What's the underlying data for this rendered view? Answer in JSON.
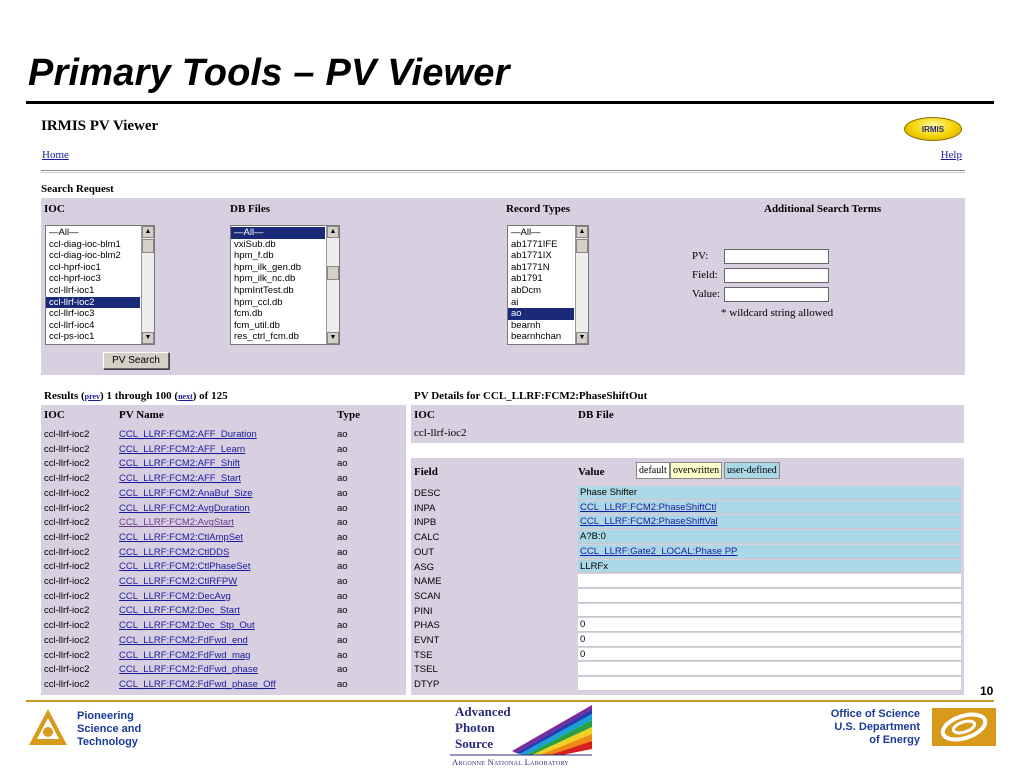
{
  "slide": {
    "title": "Primary Tools – PV Viewer",
    "page_number": "10",
    "footer_left": [
      "Pioneering",
      "Science and",
      "Technology"
    ],
    "aps_lines": [
      "Advanced",
      "Photon",
      "Source"
    ],
    "aps_sub": "Argonne National Laboratory",
    "footer_right": [
      "Office of Science",
      "U.S. Department",
      "of Energy"
    ]
  },
  "app": {
    "title": "IRMIS PV Viewer",
    "badge": "IRMIS",
    "home_link": "Home",
    "help_link": "Help",
    "search_heading": "Search Request"
  },
  "search": {
    "headers": {
      "ioc": "IOC",
      "db_files": "DB Files",
      "record_types": "Record Types",
      "additional": "Additional Search Terms"
    },
    "ioc_options": [
      "—All—",
      "ccl-diag-ioc-blm1",
      "ccl-diag-ioc-blm2",
      "ccl-hprf-ioc1",
      "ccl-hprf-ioc3",
      "ccl-llrf-ioc1",
      "ccl-llrf-ioc2",
      "ccl-llrf-ioc3",
      "ccl-llrf-ioc4",
      "ccl-ps-ioc1"
    ],
    "ioc_selected": 6,
    "db_options": [
      "—All—",
      "vxiSub.db",
      "hpm_f.db",
      "hpm_ilk_gen.db",
      "hpm_ilk_nc.db",
      "hpmIntTest.db",
      "hpm_ccl.db",
      "fcm.db",
      "fcm_util.db",
      "res_ctrl_fcm.db"
    ],
    "db_selected": 0,
    "record_options": [
      "—All—",
      "ab1771IFE",
      "ab1771IX",
      "ab1771N",
      "ab1791",
      "abDcm",
      "ai",
      "ao",
      "bearnh",
      "bearnhchan"
    ],
    "record_selected": 7,
    "pv_label": "PV:",
    "field_label": "Field:",
    "value_label": "Value:",
    "pv_value": "",
    "field_value": "",
    "value_value": "",
    "wildcard_note": "* wildcard string allowed",
    "button_label": "PV Search"
  },
  "results": {
    "prefix": "Results (",
    "prev_label": "prev",
    "middle": ") 1 through 100 (",
    "next_label": "next",
    "suffix": ") of 125",
    "headers": {
      "ioc": "IOC",
      "pv_name": "PV Name",
      "type": "Type"
    },
    "rows": [
      {
        "ioc": "ccl-llrf-ioc2",
        "pv": "CCL_LLRF:FCM2:AFF_Duration",
        "type": "ao"
      },
      {
        "ioc": "ccl-llrf-ioc2",
        "pv": "CCL_LLRF:FCM2:AFF_Learn",
        "type": "ao"
      },
      {
        "ioc": "ccl-llrf-ioc2",
        "pv": "CCL_LLRF:FCM2:AFF_Shift",
        "type": "ao"
      },
      {
        "ioc": "ccl-llrf-ioc2",
        "pv": "CCL_LLRF:FCM2:AFF_Start",
        "type": "ao"
      },
      {
        "ioc": "ccl-llrf-ioc2",
        "pv": "CCL_LLRF:FCM2:AnaBuf_Size",
        "type": "ao"
      },
      {
        "ioc": "ccl-llrf-ioc2",
        "pv": "CCL_LLRF:FCM2:AvgDuration",
        "type": "ao"
      },
      {
        "ioc": "ccl-llrf-ioc2",
        "pv": "CCL_LLRF:FCM2:AvgStart",
        "type": "ao"
      },
      {
        "ioc": "ccl-llrf-ioc2",
        "pv": "CCL_LLRF:FCM2:CtlAmpSet",
        "type": "ao"
      },
      {
        "ioc": "ccl-llrf-ioc2",
        "pv": "CCL_LLRF:FCM2:CtlDDS",
        "type": "ao"
      },
      {
        "ioc": "ccl-llrf-ioc2",
        "pv": "CCL_LLRF:FCM2:CtlPhaseSet",
        "type": "ao"
      },
      {
        "ioc": "ccl-llrf-ioc2",
        "pv": "CCL_LLRF:FCM2:CtlRFPW",
        "type": "ao"
      },
      {
        "ioc": "ccl-llrf-ioc2",
        "pv": "CCL_LLRF:FCM2:DecAvg",
        "type": "ao"
      },
      {
        "ioc": "ccl-llrf-ioc2",
        "pv": "CCL_LLRF:FCM2:Dec_Start",
        "type": "ao"
      },
      {
        "ioc": "ccl-llrf-ioc2",
        "pv": "CCL_LLRF:FCM2:Dec_Stp_Out",
        "type": "ao"
      },
      {
        "ioc": "ccl-llrf-ioc2",
        "pv": "CCL_LLRF:FCM2:FdFwd_end",
        "type": "ao"
      },
      {
        "ioc": "ccl-llrf-ioc2",
        "pv": "CCL_LLRF:FCM2:FdFwd_mag",
        "type": "ao"
      },
      {
        "ioc": "ccl-llrf-ioc2",
        "pv": "CCL_LLRF:FCM2:FdFwd_phase",
        "type": "ao"
      },
      {
        "ioc": "ccl-llrf-ioc2",
        "pv": "CCL_LLRF:FCM2:FdFwd_phase_Off",
        "type": "ao"
      }
    ]
  },
  "details": {
    "heading": "PV Details for CCL_LLRF:FCM2:PhaseShiftOut",
    "ioc_header": "IOC",
    "db_file_header": "DB File",
    "ioc_value": "ccl-llrf-ioc2",
    "field_header": "Field",
    "value_header": "Value",
    "legend": {
      "default": "default",
      "overwritten": "overwritten",
      "user_defined": "user-defined"
    },
    "legend_colors": {
      "default": "#ffffff",
      "overwritten": "#ffffcc",
      "user_defined": "#aad8e6"
    },
    "fields": [
      {
        "name": "DESC",
        "value": "Phase Shifter",
        "link": false,
        "kind": "udef"
      },
      {
        "name": "INPA",
        "value": "CCL_LLRF:FCM2:PhaseShiftCtl",
        "link": true,
        "kind": "udef"
      },
      {
        "name": "INPB",
        "value": "CCL_LLRF:FCM2:PhaseShiftVal",
        "link": true,
        "kind": "udef"
      },
      {
        "name": "CALC",
        "value": "A?B:0",
        "link": false,
        "kind": "udef"
      },
      {
        "name": "OUT",
        "value": "CCL_LLRF:Gate2_LOCAL:Phase PP",
        "link": true,
        "kind": "udef"
      },
      {
        "name": "ASG",
        "value": "LLRFx",
        "link": false,
        "kind": "udef"
      },
      {
        "name": "NAME",
        "value": "",
        "link": false,
        "kind": "plain"
      },
      {
        "name": "SCAN",
        "value": "",
        "link": false,
        "kind": "plain"
      },
      {
        "name": "PINI",
        "value": "",
        "link": false,
        "kind": "plain"
      },
      {
        "name": "PHAS",
        "value": "0",
        "link": false,
        "kind": "plain"
      },
      {
        "name": "EVNT",
        "value": "0",
        "link": false,
        "kind": "plain"
      },
      {
        "name": "TSE",
        "value": "0",
        "link": false,
        "kind": "plain"
      },
      {
        "name": "TSEL",
        "value": "",
        "link": false,
        "kind": "plain"
      },
      {
        "name": "DTYP",
        "value": "",
        "link": false,
        "kind": "plain"
      }
    ]
  }
}
